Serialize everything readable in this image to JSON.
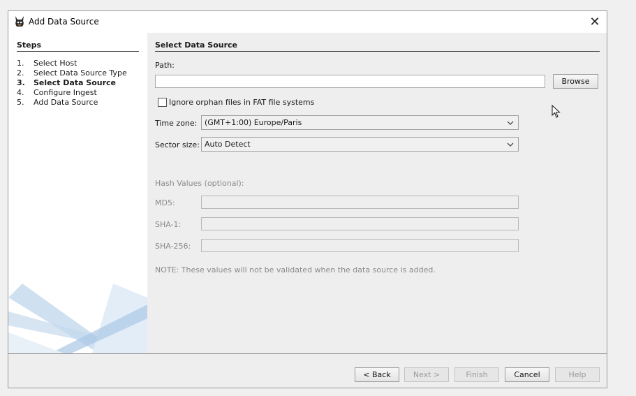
{
  "window": {
    "title": "Add Data Source",
    "close_glyph": "✕"
  },
  "steps": {
    "heading": "Steps",
    "items": [
      {
        "num": "1.",
        "label": "Select Host"
      },
      {
        "num": "2.",
        "label": "Select Data Source Type"
      },
      {
        "num": "3.",
        "label": "Select Data Source"
      },
      {
        "num": "4.",
        "label": "Configure Ingest"
      },
      {
        "num": "5.",
        "label": "Add Data Source"
      }
    ],
    "current_index": 2
  },
  "form": {
    "heading": "Select Data Source",
    "path_label": "Path:",
    "path_value": "",
    "browse_label": "Browse",
    "orphan_checkbox_label": "Ignore orphan files in FAT file systems",
    "orphan_checked": false,
    "timezone_label": "Time zone:",
    "timezone_value": "(GMT+1:00) Europe/Paris",
    "sector_label": "Sector size:",
    "sector_value": "Auto Detect",
    "hash_heading": "Hash Values (optional):",
    "md5_label": "MD5:",
    "sha1_label": "SHA-1:",
    "sha256_label": "SHA-256:",
    "note": "NOTE: These values will not be validated when the data source is added."
  },
  "footer": {
    "back_label": "< Back",
    "next_label": "Next >",
    "finish_label": "Finish",
    "cancel_label": "Cancel",
    "help_label": "Help"
  },
  "icons": {
    "app": "autopsy-dog-icon",
    "close": "close-icon",
    "dropdown": "chevron-down-icon",
    "cursor": "mouse-pointer-icon"
  },
  "colors": {
    "disabled_text": "#8a8a8a",
    "panel_white": "#ffffff",
    "dialog_bg": "#eeeeee",
    "decor_blue": "#6a9bd0"
  }
}
